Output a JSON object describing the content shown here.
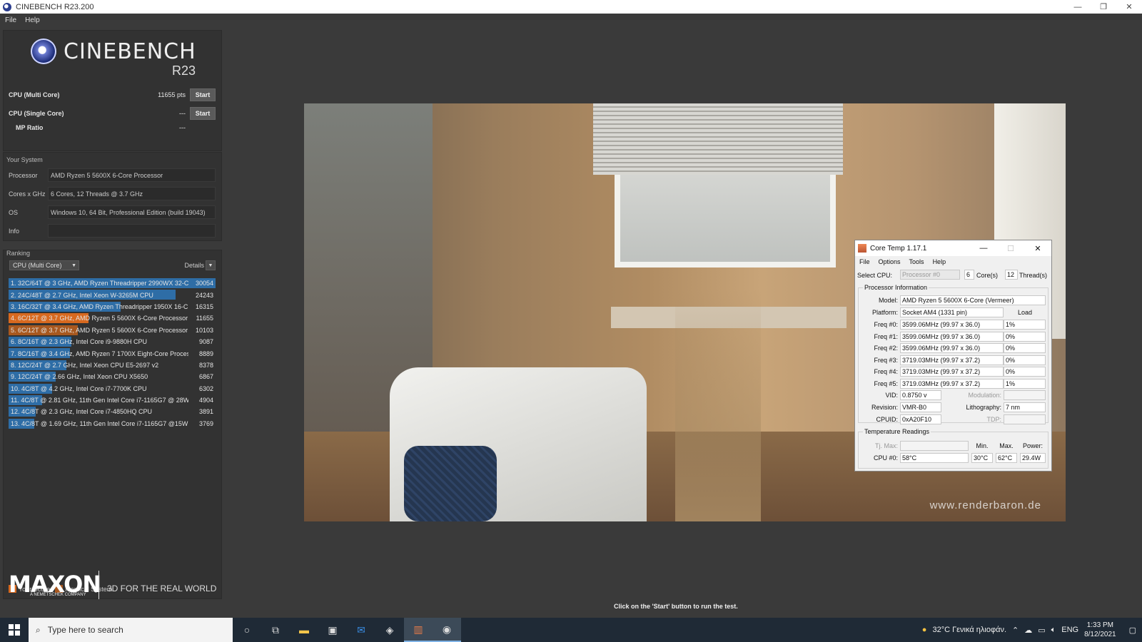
{
  "window": {
    "title": "CINEBENCH R23.200",
    "controls": [
      "—",
      "❐",
      "✕"
    ]
  },
  "menu": [
    "File",
    "Help"
  ],
  "logo": {
    "title": "CINEBENCH",
    "version": "R23"
  },
  "benchmarks": {
    "multi": {
      "label": "CPU (Multi Core)",
      "score": "11655 pts",
      "button": "Start"
    },
    "single": {
      "label": "CPU (Single Core)",
      "score": "---",
      "button": "Start"
    },
    "mp": {
      "label": "MP Ratio",
      "score": "---"
    }
  },
  "system": {
    "title": "Your System",
    "rows": [
      {
        "key": "Processor",
        "value": "AMD Ryzen 5 5600X 6-Core Processor"
      },
      {
        "key": "Cores x GHz",
        "value": "6 Cores, 12 Threads @ 3.7 GHz"
      },
      {
        "key": "OS",
        "value": "Windows 10, 64 Bit, Professional Edition (build 19043)"
      },
      {
        "key": "Info",
        "value": ""
      }
    ]
  },
  "ranking": {
    "title": "Ranking",
    "dropdown": "CPU (Multi Core)",
    "details": "Details",
    "max_score": 30054,
    "items": [
      {
        "label": "1. 32C/64T @ 3 GHz, AMD Ryzen Threadripper 2990WX 32-C",
        "score": 30054,
        "kind": "other"
      },
      {
        "label": "2. 24C/48T @ 2.7 GHz, Intel Xeon W-3265M CPU",
        "score": 24243,
        "kind": "other"
      },
      {
        "label": "3. 16C/32T @ 3.4 GHz, AMD Ryzen Threadripper 1950X 16-C",
        "score": 16315,
        "kind": "other"
      },
      {
        "label": "4. 6C/12T @ 3.7 GHz, AMD Ryzen 5 5600X 6-Core Processor",
        "score": 11655,
        "kind": "yours"
      },
      {
        "label": "5. 6C/12T @ 3.7 GHz, AMD Ryzen 5 5600X 6-Core Processor",
        "score": 10103,
        "kind": "identical"
      },
      {
        "label": "6. 8C/16T @ 2.3 GHz, Intel Core i9-9880H CPU",
        "score": 9087,
        "kind": "other"
      },
      {
        "label": "7. 8C/16T @ 3.4 GHz, AMD Ryzen 7 1700X Eight-Core Process",
        "score": 8889,
        "kind": "other"
      },
      {
        "label": "8. 12C/24T @ 2.7 GHz, Intel Xeon CPU E5-2697 v2",
        "score": 8378,
        "kind": "other"
      },
      {
        "label": "9. 12C/24T @ 2.66 GHz, Intel Xeon CPU X5650",
        "score": 6867,
        "kind": "other"
      },
      {
        "label": "10. 4C/8T @ 4.2 GHz, Intel Core i7-7700K CPU",
        "score": 6302,
        "kind": "other"
      },
      {
        "label": "11. 4C/8T @ 2.81 GHz, 11th Gen Intel Core i7-1165G7 @ 28W",
        "score": 4904,
        "kind": "other"
      },
      {
        "label": "12. 4C/8T @ 2.3 GHz, Intel Core i7-4850HQ CPU",
        "score": 3891,
        "kind": "other"
      },
      {
        "label": "13. 4C/8T @ 1.69 GHz, 11th Gen Intel Core i7-1165G7 @15W",
        "score": 3769,
        "kind": "other"
      }
    ],
    "legend": {
      "yours": "Your Score",
      "identical": "Identical System"
    },
    "colors": {
      "other": "#2e6da6",
      "yours": "#d8691f",
      "identical": "#a8581f"
    }
  },
  "maxon": {
    "logo": "MAXON",
    "sub": "A NEMETSCHEK COMPANY",
    "tagline": "3D FOR THE REAL WORLD"
  },
  "render": {
    "watermark": "www.renderbaron.de"
  },
  "status": "Click on the 'Start' button to run the test.",
  "coretemp": {
    "title": "Core Temp 1.17.1",
    "menu": [
      "File",
      "Options",
      "Tools",
      "Help"
    ],
    "select_cpu_label": "Select CPU:",
    "select_cpu_value": "Processor #0",
    "cores": "6",
    "cores_label": "Core(s)",
    "threads": "12",
    "threads_label": "Thread(s)",
    "proc_info_title": "Processor Information",
    "model_label": "Model:",
    "model": "AMD Ryzen 5 5600X 6-Core (Vermeer)",
    "platform_label": "Platform:",
    "platform": "Socket AM4 (1331 pin)",
    "load_label": "Load",
    "freqs": [
      {
        "label": "Freq #0:",
        "value": "3599.06MHz (99.97 x 36.0)",
        "load": "1%"
      },
      {
        "label": "Freq #1:",
        "value": "3599.06MHz (99.97 x 36.0)",
        "load": "0%"
      },
      {
        "label": "Freq #2:",
        "value": "3599.06MHz (99.97 x 36.0)",
        "load": "0%"
      },
      {
        "label": "Freq #3:",
        "value": "3719.03MHz (99.97 x 37.2)",
        "load": "0%"
      },
      {
        "label": "Freq #4:",
        "value": "3719.03MHz (99.97 x 37.2)",
        "load": "0%"
      },
      {
        "label": "Freq #5:",
        "value": "3719.03MHz (99.97 x 37.2)",
        "load": "1%"
      }
    ],
    "vid_label": "VID:",
    "vid": "0.8750 v",
    "modulation_label": "Modulation:",
    "revision_label": "Revision:",
    "revision": "VMR-B0",
    "litho_label": "Lithography:",
    "litho": "7 nm",
    "cpuid_label": "CPUID:",
    "cpuid": "0xA20F10",
    "tdp_label": "TDP:",
    "temp_title": "Temperature Readings",
    "tjmax_label": "Tj. Max:",
    "min_label": "Min.",
    "max_label": "Max.",
    "power_label": "Power:",
    "cpu0_label": "CPU #0:",
    "cpu0_temp": "58°C",
    "cpu0_min": "30°C",
    "cpu0_max": "62°C",
    "cpu0_power": "29.4W"
  },
  "taskbar": {
    "search_placeholder": "Type here to search",
    "weather": "32°C  Γενικά ηλιοφάν.",
    "lang": "ENG",
    "time": "1:33 PM",
    "date": "8/12/2021"
  }
}
